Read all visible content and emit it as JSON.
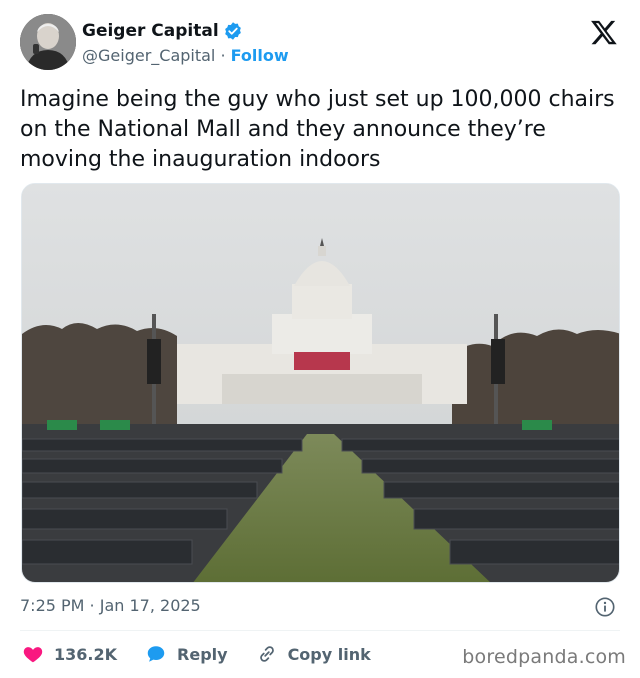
{
  "author": {
    "display_name": "Geiger Capital",
    "handle": "@Geiger_Capital",
    "separator": " · ",
    "follow_label": "Follow",
    "verified": true
  },
  "tweet": {
    "text": "Imagine being the guy who just set up 100,000 chairs on the National Mall and they announce they’re moving the inauguration indoors",
    "timestamp": "7:25 PM · Jan 17, 2025"
  },
  "actions": {
    "likes": "136.2K",
    "reply_label": "Reply",
    "copy_label": "Copy link"
  },
  "icons": {
    "platform_logo": "x-logo-icon",
    "verified": "verified-badge-icon",
    "info": "info-icon",
    "like": "heart-icon",
    "reply": "reply-bubble-icon",
    "copy": "link-icon"
  },
  "colors": {
    "accent": "#1d9bf0",
    "like": "#f91880",
    "text_secondary": "#536471"
  },
  "watermark": "boredpanda.com"
}
